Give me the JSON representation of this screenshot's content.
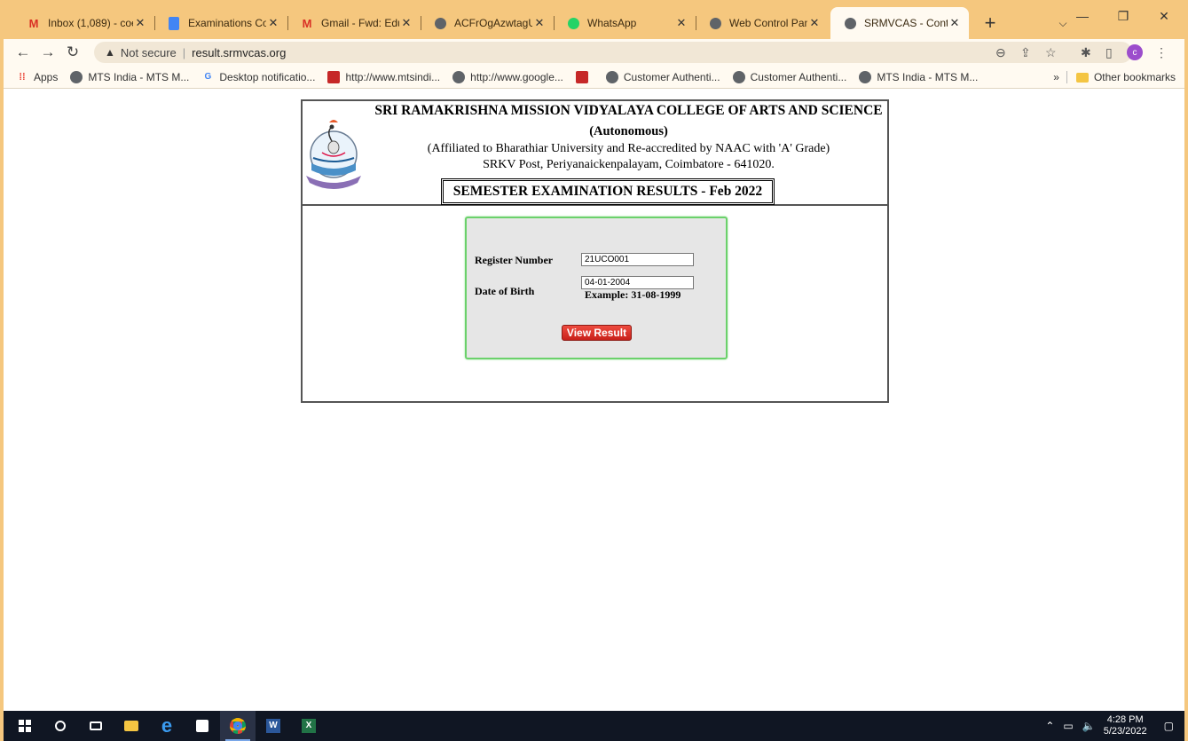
{
  "browser": {
    "tabs": [
      {
        "title": "Inbox (1,089) - coe",
        "icon": "gmail-icon",
        "active": false
      },
      {
        "title": "Examinations Comr",
        "icon": "docs-icon",
        "active": false
      },
      {
        "title": "Gmail - Fwd: Educa",
        "icon": "gmail-icon",
        "active": false
      },
      {
        "title": "ACFrOgAzwtagUsl",
        "icon": "globe-icon",
        "active": false
      },
      {
        "title": "WhatsApp",
        "icon": "whatsapp-icon",
        "active": false
      },
      {
        "title": "Web Control Panel",
        "icon": "globe-icon",
        "active": false
      },
      {
        "title": "SRMVCAS - Contro",
        "icon": "globe-icon",
        "active": true
      }
    ],
    "address": {
      "security_label": "Not secure",
      "url": "result.srmvcas.org"
    },
    "bookmarks": [
      {
        "label": "Apps",
        "icon": "apps-grid-icon"
      },
      {
        "label": "MTS India - MTS M...",
        "icon": "globe-icon"
      },
      {
        "label": "Desktop notificatio...",
        "icon": "google-icon"
      },
      {
        "label": "http://www.mtsindi...",
        "icon": "pdf-icon"
      },
      {
        "label": "http://www.google...",
        "icon": "globe-icon"
      },
      {
        "label": "",
        "icon": "pdf-icon"
      },
      {
        "label": "Customer Authenti...",
        "icon": "globe-icon"
      },
      {
        "label": "Customer Authenti...",
        "icon": "globe-icon"
      },
      {
        "label": "MTS India - MTS M...",
        "icon": "globe-icon"
      }
    ],
    "other_bookmarks": "Other bookmarks",
    "profile_initial": "c"
  },
  "page": {
    "college_name": "SRI RAMAKRISHNA MISSION VIDYALAYA COLLEGE OF ARTS AND SCIENCE",
    "autonomous": "(Autonomous)",
    "affiliation": "(Affiliated to Bharathiar University and Re-accredited by NAAC with 'A' Grade)",
    "address": "SRKV Post, Periyanaickenpalayam, Coimbatore - 641020.",
    "exam_title": "SEMESTER EXAMINATION RESULTS - Feb 2022",
    "form": {
      "register_label": "Register Number",
      "register_value": "21UCO001",
      "dob_label": "Date of Birth",
      "dob_value": "04-01-2004",
      "dob_example": "Example: 31-08-1999",
      "submit_label": "View Result"
    }
  },
  "taskbar": {
    "time": "4:28 PM",
    "date": "5/23/2022"
  }
}
